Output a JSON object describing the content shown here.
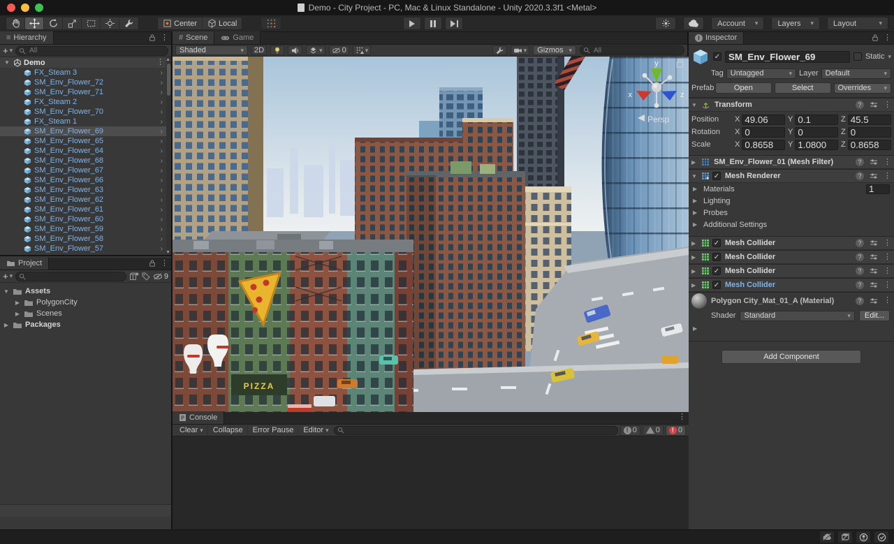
{
  "window": {
    "title": "Demo - City Project - PC, Mac & Linux Standalone - Unity 2020.3.3f1 <Metal>"
  },
  "toolbar": {
    "pivot": "Center",
    "space": "Local",
    "account": "Account",
    "layers": "Layers",
    "layout": "Layout"
  },
  "hierarchy": {
    "tab": "Hierarchy",
    "search_placeholder": "All",
    "scene_name": "Demo",
    "items": [
      {
        "label": "FX_Steam 3"
      },
      {
        "label": "SM_Env_Flower_72"
      },
      {
        "label": "SM_Env_Flower_71"
      },
      {
        "label": "FX_Steam 2"
      },
      {
        "label": "SM_Env_Flower_70"
      },
      {
        "label": "FX_Steam 1"
      },
      {
        "label": "SM_Env_Flower_69",
        "selected": true
      },
      {
        "label": "SM_Env_Flower_65"
      },
      {
        "label": "SM_Env_Flower_64"
      },
      {
        "label": "SM_Env_Flower_68"
      },
      {
        "label": "SM_Env_Flower_67"
      },
      {
        "label": "SM_Env_Flower_66"
      },
      {
        "label": "SM_Env_Flower_63"
      },
      {
        "label": "SM_Env_Flower_62"
      },
      {
        "label": "SM_Env_Flower_61"
      },
      {
        "label": "SM_Env_Flower_60"
      },
      {
        "label": "SM_Env_Flower_59"
      },
      {
        "label": "SM_Env_Flower_58"
      },
      {
        "label": "SM_Env_Flower_57"
      }
    ]
  },
  "project": {
    "tab": "Project",
    "hidden_count": "9",
    "items": [
      {
        "label": "Assets"
      },
      {
        "label": "PolygonCity"
      },
      {
        "label": "Scenes"
      },
      {
        "label": "Packages"
      }
    ]
  },
  "scene_view": {
    "scene_tab": "Scene",
    "game_tab": "Game",
    "shading_mode": "Shaded",
    "mode_2d": "2D",
    "hidden_count": "0",
    "gizmos": "Gizmos",
    "search_placeholder": "All",
    "axis_x": "x",
    "axis_y": "y",
    "axis_z": "z",
    "projection": "Persp",
    "pizza_sign": "PIZZA"
  },
  "console": {
    "tab": "Console",
    "clear": "Clear",
    "collapse": "Collapse",
    "error_pause": "Error Pause",
    "editor": "Editor",
    "info_count": "0",
    "warning_count": "0",
    "error_count": "0"
  },
  "inspector": {
    "tab": "Inspector",
    "object_name": "SM_Env_Flower_69",
    "static_label": "Static",
    "tag_label": "Tag",
    "tag": "Untagged",
    "layer_label": "Layer",
    "layer": "Default",
    "prefab_label": "Prefab",
    "open": "Open",
    "select": "Select",
    "overrides": "Overrides",
    "transform": {
      "title": "Transform",
      "axes": [
        "X",
        "Y",
        "Z"
      ],
      "rows": [
        {
          "label": "Position",
          "values": [
            "49.06",
            "0.1",
            "45.5"
          ]
        },
        {
          "label": "Rotation",
          "values": [
            "0",
            "0",
            "0"
          ]
        },
        {
          "label": "Scale",
          "values": [
            "0.8658",
            "1.0800",
            "0.8658"
          ]
        }
      ]
    },
    "mesh_filter": {
      "title": "SM_Env_Flower_01 (Mesh Filter)"
    },
    "mesh_renderer": {
      "title": "Mesh Renderer",
      "materials_label": "Materials",
      "materials_size": "1",
      "foldouts": [
        "Lighting",
        "Probes",
        "Additional Settings"
      ]
    },
    "colliders": [
      {
        "title": "Mesh Collider"
      },
      {
        "title": "Mesh Collider"
      },
      {
        "title": "Mesh Collider"
      },
      {
        "title": "Mesh Collider",
        "override": true
      }
    ],
    "material": {
      "title": "Polygon City_Mat_01_A (Material)",
      "shader_label": "Shader",
      "shader": "Standard",
      "edit": "Edit..."
    },
    "add_component": "Add Component"
  },
  "colors": {
    "prefab_text": "#80b4e6",
    "selection": "#4d4d4d",
    "error": "#d64545",
    "accent_orange": "#e07b39"
  }
}
